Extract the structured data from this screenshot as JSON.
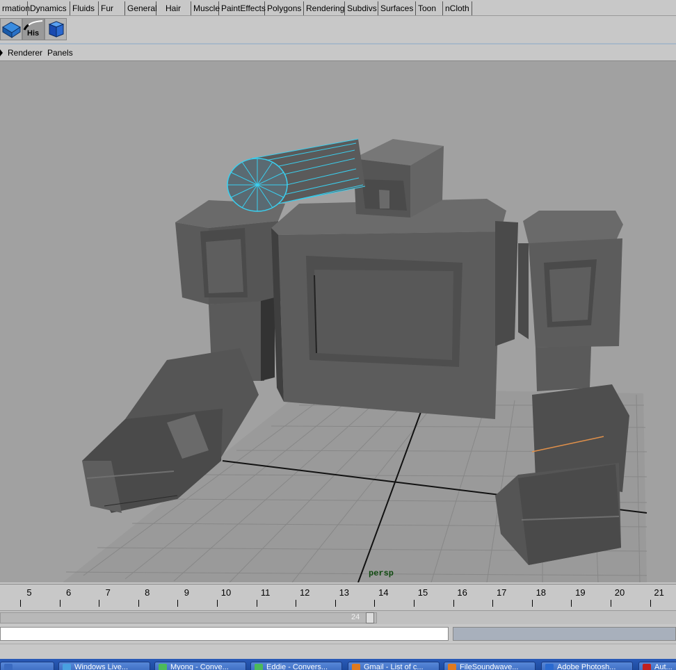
{
  "shelf_tabs": [
    "rmation",
    "Dynamics",
    "Fluids",
    "Fur",
    "General",
    "Hair",
    "Muscle",
    "PaintEffects",
    "Polygons",
    "Rendering",
    "Subdivs",
    "Surfaces",
    "Toon",
    "nCloth"
  ],
  "shelf_buttons": [
    {
      "name": "polygon-plane-icon",
      "label": ""
    },
    {
      "name": "history-icon",
      "label": "His"
    },
    {
      "name": "polygon-cube-icon",
      "label": ""
    }
  ],
  "panel_menu": {
    "renderer": "Renderer",
    "panels": "Panels"
  },
  "viewport": {
    "camera_label": "persp",
    "background": "#a1a1a1",
    "selection_color": "#3ad0f0"
  },
  "timeline": {
    "ticks": [
      "5",
      "6",
      "7",
      "8",
      "9",
      "10",
      "11",
      "12",
      "13",
      "14",
      "15",
      "16",
      "17",
      "18",
      "19",
      "20",
      "21"
    ]
  },
  "range_slider": {
    "value": "24"
  },
  "taskbar": {
    "items": [
      {
        "label": "",
        "icon_color": "#3a6ac0"
      },
      {
        "label": "Windows Live...",
        "icon_color": "#49a0e0"
      },
      {
        "label": "Myong - Conve...",
        "icon_color": "#4cba5a"
      },
      {
        "label": "Eddie - Convers...",
        "icon_color": "#4cba5a"
      },
      {
        "label": "Gmail - List of c...",
        "icon_color": "#e07a20"
      },
      {
        "label": "FileSoundwave...",
        "icon_color": "#e07a20"
      },
      {
        "label": "Adobe Photosh...",
        "icon_color": "#2a6ad0"
      },
      {
        "label": "Aut...",
        "icon_color": "#c02020"
      }
    ]
  }
}
